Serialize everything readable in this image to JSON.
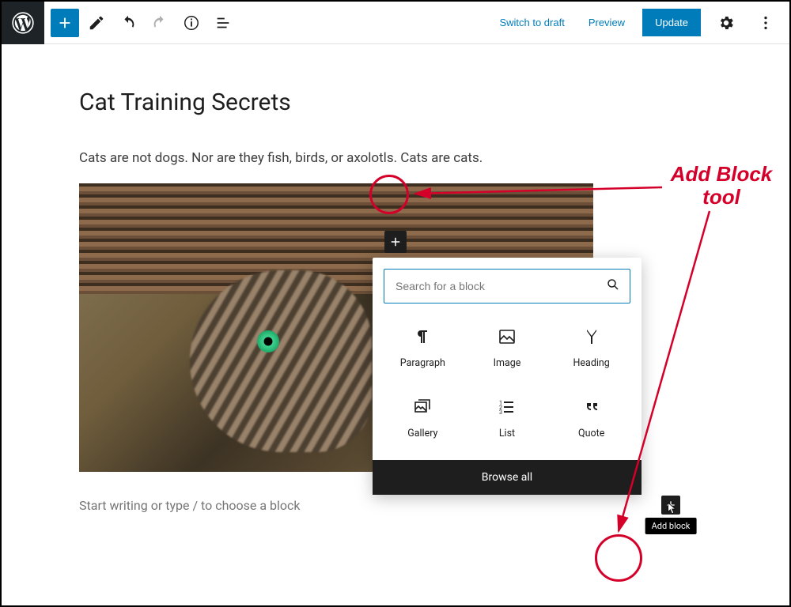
{
  "topbar": {
    "switch_draft": "Switch to draft",
    "preview": "Preview",
    "update": "Update"
  },
  "post": {
    "title": "Cat Training Secrets",
    "paragraph": "Cats are not dogs. Nor are they fish, birds, or axolotls. Cats are cats.",
    "placeholder": "Start writing or type / to choose a block"
  },
  "inserter": {
    "search_placeholder": "Search for a block",
    "browse_all": "Browse all",
    "blocks": {
      "paragraph": "Paragraph",
      "image": "Image",
      "heading": "Heading",
      "gallery": "Gallery",
      "list": "List",
      "quote": "Quote"
    }
  },
  "tooltip": {
    "add_block": "Add block"
  },
  "annotation": {
    "label_l1": "Add Block",
    "label_l2": "tool"
  }
}
